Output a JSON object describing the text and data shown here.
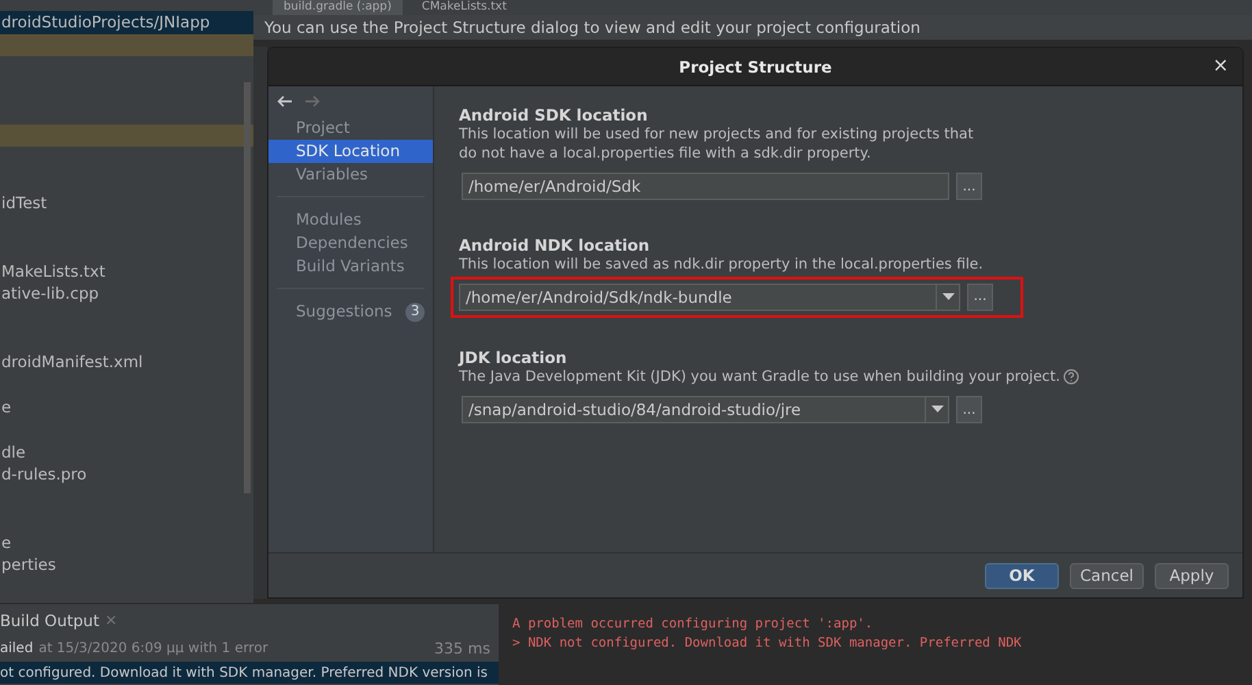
{
  "editor_tabs": [
    {
      "label": "build.gradle (:app)",
      "selected": true
    },
    {
      "label": "CMakeLists.txt",
      "selected": false
    }
  ],
  "project_tree": [
    {
      "label": "droidStudioProjects/JNIapp",
      "selected": true,
      "highlighted": false
    },
    {
      "selected": false,
      "highlighted": true
    },
    {
      "selected": false,
      "highlighted": false
    },
    {
      "selected": false,
      "highlighted": false
    },
    {
      "selected": false,
      "highlighted": false
    },
    {
      "selected": false,
      "highlighted": true
    },
    {
      "selected": false,
      "highlighted": false
    },
    {
      "selected": false,
      "highlighted": false
    },
    {
      "label": "idTest",
      "selected": false,
      "highlighted": false
    },
    {
      "selected": false,
      "highlighted": false
    },
    {
      "selected": false,
      "highlighted": false
    },
    {
      "label": "MakeLists.txt",
      "selected": false,
      "highlighted": false
    },
    {
      "label": "ative-lib.cpp",
      "selected": false,
      "highlighted": false
    },
    {
      "selected": false,
      "highlighted": false
    },
    {
      "selected": false,
      "highlighted": false
    },
    {
      "label": "droidManifest.xml",
      "selected": false,
      "highlighted": false
    },
    {
      "selected": false,
      "highlighted": false
    },
    {
      "label": "e",
      "selected": false,
      "highlighted": false
    },
    {
      "selected": false,
      "highlighted": false
    },
    {
      "label": "dle",
      "selected": false,
      "highlighted": false
    },
    {
      "label": "d-rules.pro",
      "selected": false,
      "highlighted": false
    },
    {
      "selected": false,
      "highlighted": false
    },
    {
      "selected": false,
      "highlighted": false
    },
    {
      "label": "e",
      "selected": false,
      "highlighted": false
    },
    {
      "label": "perties",
      "selected": false,
      "highlighted": false
    }
  ],
  "banner": "You can use the Project Structure dialog to view and edit your project configuration",
  "dialog": {
    "title": "Project Structure",
    "close": "×",
    "nav": [
      {
        "group": [
          {
            "label": "Project",
            "selected": false
          },
          {
            "label": "SDK Location",
            "selected": true
          },
          {
            "label": "Variables",
            "selected": false
          }
        ]
      },
      {
        "group": [
          {
            "label": "Modules",
            "selected": false
          },
          {
            "label": "Dependencies",
            "selected": false
          },
          {
            "label": "Build Variants",
            "selected": false
          }
        ]
      },
      {
        "group": [
          {
            "label": "Suggestions",
            "selected": false,
            "badge": "3"
          }
        ]
      }
    ],
    "sections": [
      {
        "title": "Android SDK location",
        "description": "This location will be used for new projects and for existing projects that do not have a local.properties file with a sdk.dir property.",
        "value": "/home/er/Android/Sdk",
        "dropdown": false,
        "help": false,
        "highlighted": false,
        "browse": "..."
      },
      {
        "title": "Android NDK location",
        "description": "This location will be saved as ndk.dir property in the local.properties file.",
        "value": "/home/er/Android/Sdk/ndk-bundle",
        "dropdown": true,
        "help": false,
        "highlighted": true,
        "browse": "..."
      },
      {
        "title": "JDK location",
        "description": "The Java Development Kit (JDK) you want Gradle to use when building your project.",
        "value": "/snap/android-studio/84/android-studio/jre",
        "dropdown": true,
        "help": true,
        "highlighted": false,
        "browse": "..."
      }
    ],
    "buttons": [
      {
        "label": "OK",
        "primary": true
      },
      {
        "label": "Cancel",
        "primary": false
      },
      {
        "label": "Apply",
        "primary": false
      }
    ]
  },
  "build_output": {
    "tab": "Build Output",
    "close": "×",
    "rows": [
      {
        "status": "ailed",
        "text": "at 15/3/2020 6:09 μμ with 1 error",
        "time": "335 ms",
        "selected": false
      },
      {
        "text": "ot configured. Download it with SDK manager. Preferred NDK version is",
        "selected": true
      }
    ],
    "log": [
      "A problem occurred configuring project ':app'.",
      "> NDK not configured. Download it with SDK manager. Preferred NDK"
    ]
  }
}
